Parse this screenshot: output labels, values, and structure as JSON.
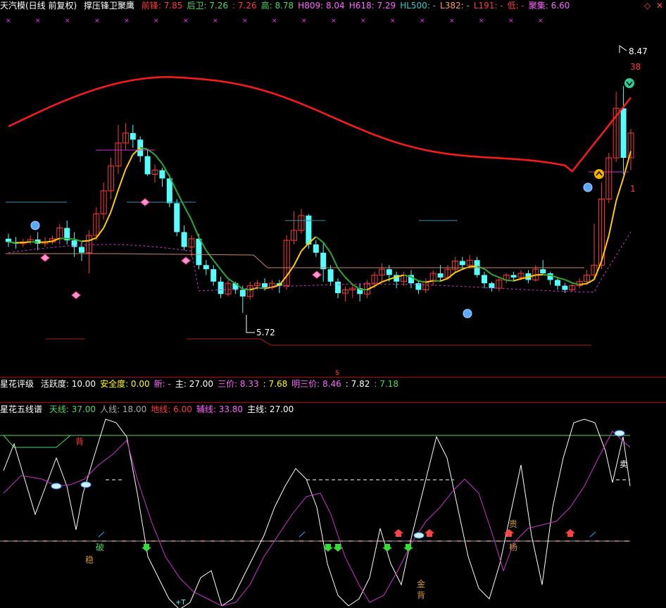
{
  "top_header": {
    "title": "天汽模(日线 前复权)",
    "indicator": "撑压锋卫聚鹰",
    "items": [
      {
        "label": "前锋",
        "value": "7.85",
        "color": "#ff3a3a"
      },
      {
        "label": "后卫",
        "value": "7.26",
        "color": "#4cd964"
      },
      {
        "label": "",
        "value": "7.26",
        "color": "#ff3a3a"
      },
      {
        "label": "高",
        "value": "8.78",
        "color": "#4cd964"
      },
      {
        "label": "H809",
        "value": "8.04",
        "color": "#ff66ff"
      },
      {
        "label": "H618",
        "value": "7.29",
        "color": "#ff66ff"
      },
      {
        "label": "HL500",
        "value": "-",
        "color": "#33cccc"
      },
      {
        "label": "L382",
        "value": "-",
        "color": "#ff9966"
      },
      {
        "label": "L191",
        "value": "-",
        "color": "#ff3a3a"
      },
      {
        "label": "低",
        "value": "-",
        "color": "#ff3a3a"
      },
      {
        "label": "聚集",
        "value": "6.60",
        "color": "#ff66ff"
      }
    ]
  },
  "mid_header": {
    "title": "星花评级",
    "items": [
      {
        "label": "活跃度",
        "value": "10.00",
        "color": "#ffffff"
      },
      {
        "label": "安全度",
        "value": "0.00",
        "color": "#ffff00"
      },
      {
        "label": "新",
        "value": "-",
        "color": "#ff66ff"
      },
      {
        "label": "主",
        "value": "27.00",
        "color": "#ffffff"
      },
      {
        "label": "三价",
        "value": "8.33",
        "color": "#ff66ff"
      },
      {
        "label": "",
        "value": "7.68",
        "color": "#ffff00"
      },
      {
        "label": "明三价",
        "value": "8.46",
        "color": "#ff66ff"
      },
      {
        "label": "",
        "value": "7.82",
        "color": "#ffffff"
      },
      {
        "label": "",
        "value": "7.18",
        "color": "#4cd964"
      }
    ]
  },
  "low_header": {
    "title": "星花五线谱",
    "items": [
      {
        "label": "天线",
        "value": "37.00",
        "color": "#4cd964"
      },
      {
        "label": "人线",
        "value": "18.00",
        "color": "#aaaaaa"
      },
      {
        "label": "地线",
        "value": "6.00",
        "color": "#ff3a3a"
      },
      {
        "label": "辅线",
        "value": "33.80",
        "color": "#ff66ff"
      },
      {
        "label": "主线",
        "value": "27.00",
        "color": "#ffffff"
      }
    ]
  },
  "annotations": {
    "high_label": "8.47",
    "low_label": "5.72",
    "count_38": "38",
    "count_1": "1",
    "bei_top": "背",
    "po": "破",
    "wen": "稳",
    "jin": "金",
    "bei_bottom": "背",
    "gui": "贵",
    "yang": "杨",
    "mai": "卖",
    "bottom_mark": "+T"
  },
  "colors": {
    "up": "#ff3a3a",
    "down": "#54ffff",
    "main_line": "#ffffff",
    "aux_line": "#cc33cc",
    "sky_line": "#4cd964",
    "red_band": "#ff1a1a",
    "ma_yellow": "#ffcc00",
    "ma_green": "#2ea82e"
  },
  "chart_data": {
    "type": "candlestick",
    "price_range": [
      5.5,
      9.0
    ],
    "annotated_high": 8.47,
    "annotated_low": 5.72,
    "candles": [
      [
        6.62,
        6.58,
        6.68,
        6.52
      ],
      [
        6.58,
        6.56,
        6.64,
        6.5
      ],
      [
        6.56,
        6.58,
        6.62,
        6.52
      ],
      [
        6.58,
        6.61,
        6.66,
        6.55
      ],
      [
        6.61,
        6.56,
        6.7,
        6.48
      ],
      [
        6.56,
        6.58,
        6.64,
        6.52
      ],
      [
        6.58,
        6.62,
        6.66,
        6.55
      ],
      [
        6.62,
        6.75,
        6.8,
        6.55
      ],
      [
        6.75,
        6.6,
        6.84,
        6.55
      ],
      [
        6.6,
        6.52,
        6.7,
        6.4
      ],
      [
        6.52,
        6.45,
        6.58,
        6.35
      ],
      [
        6.45,
        6.66,
        6.72,
        6.2
      ],
      [
        6.66,
        6.92,
        7.0,
        6.6
      ],
      [
        6.92,
        7.2,
        7.3,
        6.85
      ],
      [
        7.2,
        7.5,
        7.6,
        7.1
      ],
      [
        7.5,
        7.78,
        8.0,
        7.4
      ],
      [
        7.78,
        7.9,
        8.02,
        7.7
      ],
      [
        7.9,
        7.82,
        8.0,
        7.72
      ],
      [
        7.82,
        7.62,
        7.86,
        7.55
      ],
      [
        7.62,
        7.4,
        7.7,
        7.38
      ],
      [
        7.4,
        7.45,
        7.52,
        7.3
      ],
      [
        7.45,
        7.35,
        7.48,
        7.25
      ],
      [
        7.35,
        7.05,
        7.4,
        7.0
      ],
      [
        7.05,
        6.7,
        7.1,
        6.65
      ],
      [
        6.7,
        6.52,
        6.78,
        6.48
      ],
      [
        6.52,
        6.62,
        6.66,
        6.4
      ],
      [
        6.62,
        6.3,
        6.68,
        6.25
      ],
      [
        6.3,
        6.25,
        6.36,
        6.18
      ],
      [
        6.25,
        6.1,
        6.3,
        6.05
      ],
      [
        6.1,
        5.95,
        6.16,
        5.9
      ],
      [
        5.95,
        6.08,
        6.12,
        5.92
      ],
      [
        6.08,
        6.0,
        6.1,
        5.95
      ],
      [
        6.0,
        5.92,
        6.05,
        5.72
      ],
      [
        5.92,
        6.05,
        6.1,
        5.88
      ],
      [
        6.05,
        6.08,
        6.12,
        6.0
      ],
      [
        6.08,
        6.03,
        6.14,
        5.99
      ],
      [
        6.03,
        6.08,
        6.12,
        6.0
      ],
      [
        6.08,
        6.05,
        6.12,
        5.96
      ],
      [
        6.05,
        6.6,
        6.66,
        6.0
      ],
      [
        6.6,
        6.72,
        6.95,
        6.55
      ],
      [
        6.72,
        6.9,
        6.98,
        6.68
      ],
      [
        6.9,
        6.55,
        6.92,
        6.5
      ],
      [
        6.55,
        6.45,
        6.6,
        6.4
      ],
      [
        6.45,
        6.25,
        6.58,
        6.1
      ],
      [
        6.25,
        6.1,
        6.3,
        6.05
      ],
      [
        6.1,
        5.96,
        6.14,
        5.9
      ],
      [
        5.96,
        6.0,
        6.04,
        5.86
      ],
      [
        6.0,
        6.02,
        6.06,
        5.9
      ],
      [
        6.02,
        5.95,
        6.08,
        5.86
      ],
      [
        5.95,
        6.08,
        6.12,
        5.9
      ],
      [
        6.08,
        6.18,
        6.22,
        6.02
      ],
      [
        6.18,
        6.25,
        6.32,
        6.1
      ],
      [
        6.25,
        6.18,
        6.3,
        6.1
      ],
      [
        6.18,
        6.1,
        6.22,
        6.02
      ],
      [
        6.1,
        6.18,
        6.22,
        6.05
      ],
      [
        6.18,
        6.08,
        6.24,
        6.02
      ],
      [
        6.08,
        6.0,
        6.12,
        5.95
      ],
      [
        6.0,
        6.1,
        6.14,
        5.96
      ],
      [
        6.1,
        6.2,
        6.24,
        6.05
      ],
      [
        6.2,
        6.15,
        6.3,
        6.1
      ],
      [
        6.15,
        6.25,
        6.3,
        6.12
      ],
      [
        6.25,
        6.35,
        6.4,
        6.2
      ],
      [
        6.35,
        6.3,
        6.4,
        6.25
      ],
      [
        6.3,
        6.36,
        6.42,
        6.26
      ],
      [
        6.36,
        6.18,
        6.4,
        6.15
      ],
      [
        6.18,
        6.08,
        6.22,
        6.02
      ],
      [
        6.08,
        6.02,
        6.1,
        5.98
      ],
      [
        6.02,
        6.12,
        6.15,
        5.98
      ],
      [
        6.12,
        6.18,
        6.2,
        6.08
      ],
      [
        6.18,
        6.15,
        6.22,
        6.1
      ],
      [
        6.15,
        6.2,
        6.24,
        6.12
      ],
      [
        6.2,
        6.12,
        6.24,
        6.08
      ],
      [
        6.12,
        6.25,
        6.3,
        6.1
      ],
      [
        6.25,
        6.2,
        6.36,
        6.18
      ],
      [
        6.2,
        6.12,
        6.22,
        6.06
      ],
      [
        6.12,
        6.05,
        6.15,
        6.0
      ],
      [
        6.05,
        6.0,
        6.08,
        5.96
      ],
      [
        6.0,
        6.05,
        6.08,
        5.98
      ],
      [
        6.05,
        6.1,
        6.14,
        6.02
      ],
      [
        6.1,
        6.18,
        6.24,
        6.06
      ],
      [
        6.18,
        6.3,
        6.8,
        6.14
      ],
      [
        6.3,
        7.1,
        7.3,
        6.25
      ],
      [
        7.1,
        7.6,
        7.66,
        7.05
      ],
      [
        7.6,
        8.2,
        8.4,
        7.55
      ],
      [
        8.2,
        7.6,
        8.47,
        7.4
      ],
      [
        7.6,
        7.9,
        7.95,
        7.45
      ]
    ]
  }
}
